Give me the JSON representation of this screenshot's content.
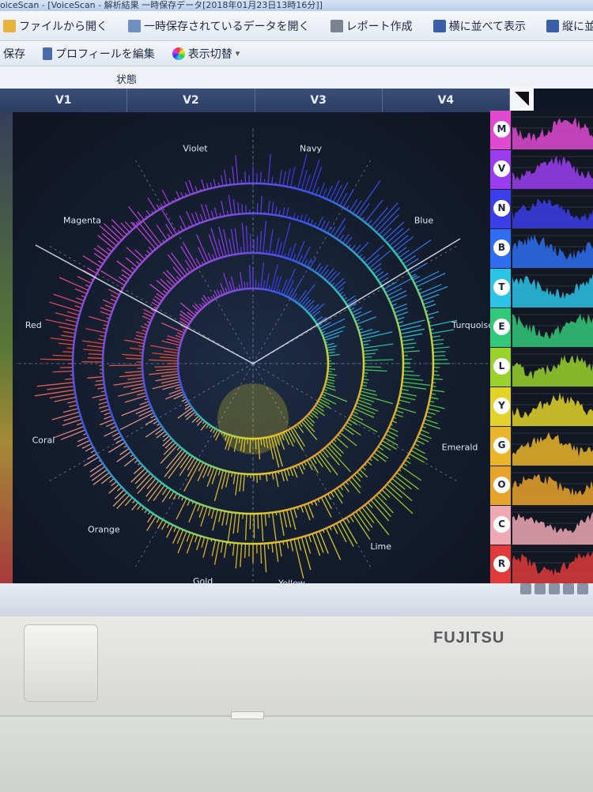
{
  "window": {
    "title": "oiceScan - [VoiceScan - 解析結果 一時保存データ[2018年01月23日13時16分]]"
  },
  "toolbar1": {
    "open_file": "ファイルから開く",
    "open_temp": "一時保存されているデータを開く",
    "report": "レポート作成",
    "tile_horizontal": "横に並べて表示",
    "tile_vertical": "縦に並べて表示"
  },
  "toolbar2": {
    "save": "保存",
    "edit_profile": "プロフィールを編集",
    "toggle_view": "表示切替",
    "dropdown_arrow": "▾"
  },
  "status": {
    "label": "状態"
  },
  "voice_tabs": [
    "V1",
    "V2",
    "V3",
    "V4"
  ],
  "radial_labels": [
    {
      "text": "Violet",
      "angle": 255
    },
    {
      "text": "Navy",
      "angle": 285
    },
    {
      "text": "Blue",
      "angle": 320
    },
    {
      "text": "Turquoise",
      "angle": 350
    },
    {
      "text": "Emerald",
      "angle": 22
    },
    {
      "text": "Lime",
      "angle": 55
    },
    {
      "text": "Yellow",
      "angle": 80
    },
    {
      "text": "Gold",
      "angle": 103
    },
    {
      "text": "Orange",
      "angle": 132
    },
    {
      "text": "Coral",
      "angle": 160
    },
    {
      "text": "Red",
      "angle": 190
    },
    {
      "text": "Magenta",
      "angle": 220
    }
  ],
  "spectrum_rows": [
    {
      "letter": "M",
      "color": "#e04ad1"
    },
    {
      "letter": "V",
      "color": "#9b3cf0"
    },
    {
      "letter": "N",
      "color": "#3b3de8"
    },
    {
      "letter": "B",
      "color": "#2f6ef0"
    },
    {
      "letter": "T",
      "color": "#2bc4e6"
    },
    {
      "letter": "E",
      "color": "#32c97a"
    },
    {
      "letter": "L",
      "color": "#9ad12c"
    },
    {
      "letter": "Y",
      "color": "#e2d22a"
    },
    {
      "letter": "G",
      "color": "#e9b52a"
    },
    {
      "letter": "O",
      "color": "#e8a32a"
    },
    {
      "letter": "C",
      "color": "#f0a8b4"
    },
    {
      "letter": "R",
      "color": "#e03a3a"
    }
  ],
  "brand": "FUJITSU"
}
